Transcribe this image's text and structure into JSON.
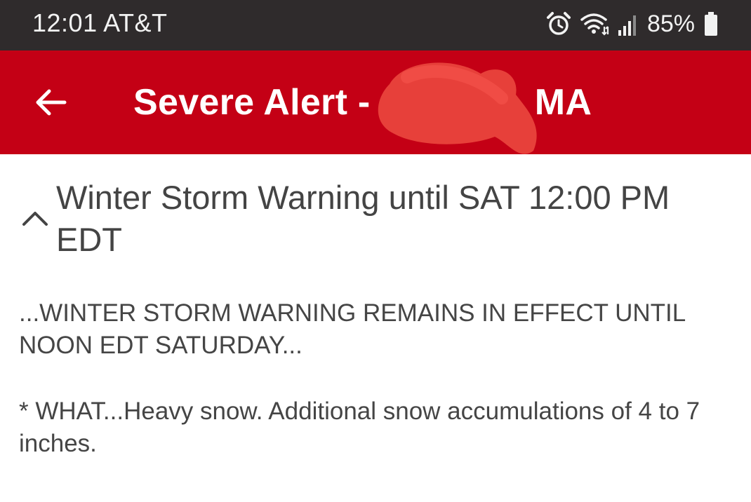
{
  "status_bar": {
    "time": "12:01",
    "carrier": "AT&T",
    "battery": "85%",
    "icons": [
      "alarm-icon",
      "wifi-icon",
      "signal-icon",
      "battery-icon"
    ]
  },
  "app_bar": {
    "title_prefix": "Severe Alert - ",
    "title_suffix": ", MA",
    "back_icon": "arrow-left-icon",
    "background_color": "#c40015"
  },
  "alert": {
    "expand_icon": "chevron-up-icon",
    "title": "Winter Storm Warning until SAT 12:00 PM EDT",
    "paragraphs": [
      "...WINTER STORM WARNING REMAINS IN EFFECT UNTIL NOON EDT SATURDAY...",
      "* WHAT...Heavy snow. Additional snow accumulations of 4 to 7 inches."
    ]
  }
}
